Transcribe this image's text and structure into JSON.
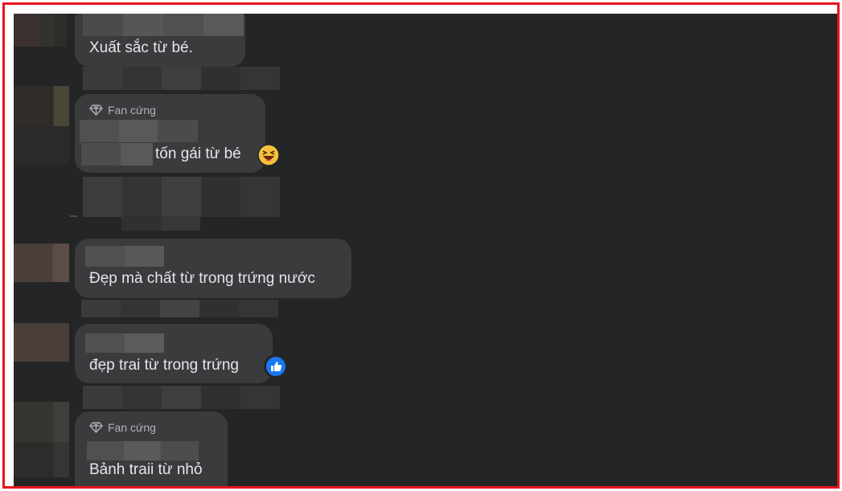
{
  "comments": [
    {
      "text": "Xuất sắc từ bé.",
      "badge": ""
    },
    {
      "text": "tốn gái từ bé",
      "badge": "Fan cứng",
      "emoji": "grinning-squinting-face-emoji"
    },
    {
      "text": "Đẹp mà chất từ trong trứng nước",
      "badge": ""
    },
    {
      "text": "đẹp trai từ trong trứng",
      "badge": "",
      "reaction": "like-reaction-icon"
    },
    {
      "text": "Bảnh traii từ nhỏ",
      "badge": "Fan cứng"
    }
  ],
  "colors": {
    "frame": "#e8141c",
    "background": "#242526",
    "bubble": "#3a3b3c",
    "text": "#e4e6eb",
    "badge_text": "#b0b3b8",
    "like_blue": "#1877f2"
  }
}
